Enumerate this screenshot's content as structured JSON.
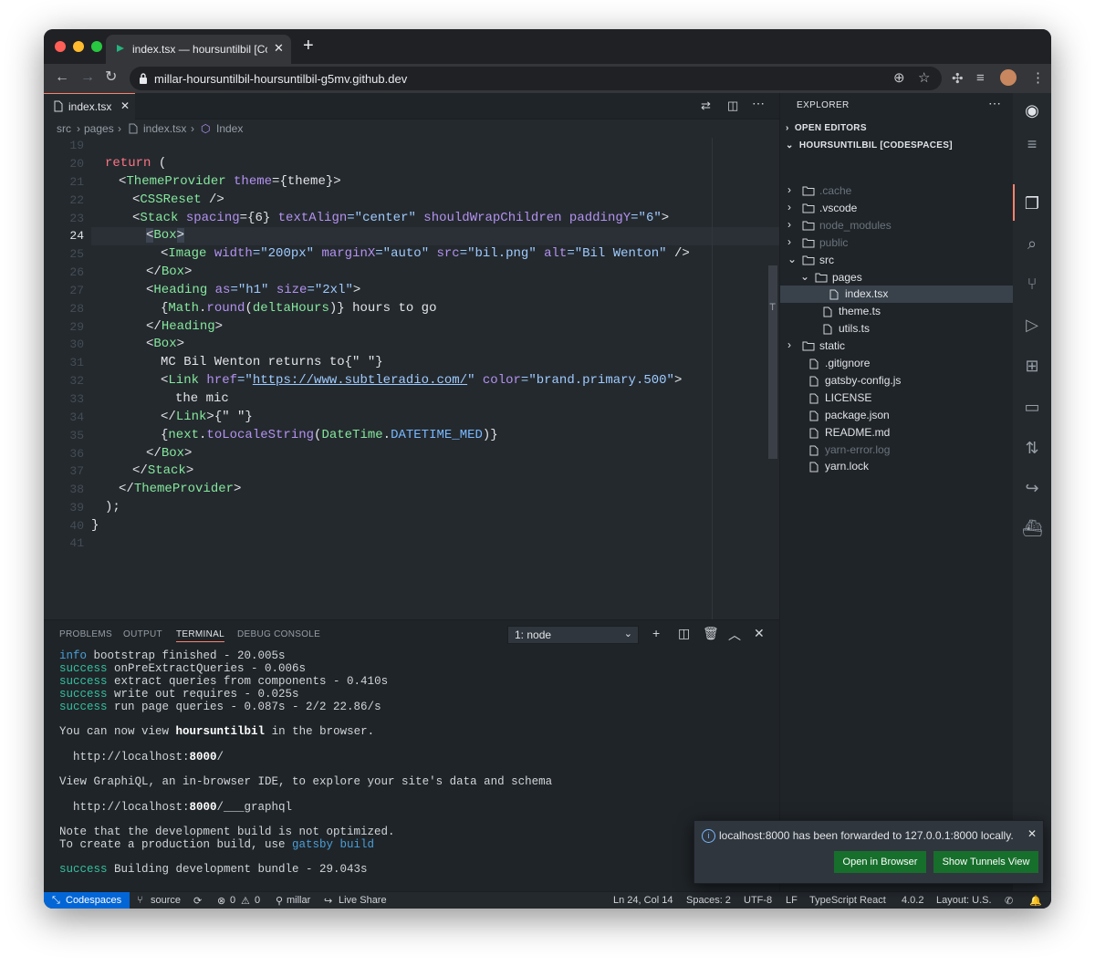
{
  "browser": {
    "tab_title": "index.tsx — hoursuntilbil [Codespaces]",
    "url": "millar-hoursuntilbil-hoursuntilbil-g5mv.github.dev"
  },
  "editor": {
    "tab": "index.tsx",
    "breadcrumb": [
      "src",
      "pages",
      "index.tsx",
      "Index"
    ],
    "line_numbers": [
      "19",
      "20",
      "21",
      "22",
      "23",
      "24",
      "25",
      "26",
      "27",
      "28",
      "29",
      "30",
      "31",
      "32",
      "33",
      "34",
      "35",
      "36",
      "37",
      "38",
      "39",
      "40",
      "41"
    ]
  },
  "code": {
    "l20_k": "return",
    "l20_p": " (",
    "l21_a": "<",
    "l21_t": "ThemeProvider",
    "l21_attr": " theme",
    "l21_rest": "={theme}>",
    "l22_a": "<",
    "l22_t": "CSSReset",
    "l22_rest": " />",
    "l23_a": "<",
    "l23_t": "Stack",
    "l23_attr1": " spacing",
    "l23_v1": "={6}",
    "l23_attr2": " textAlign",
    "l23_v2": "=\"center\"",
    "l23_attr3": " shouldWrapChildren",
    "l23_attr4": " paddingY",
    "l23_v4": "=\"6\"",
    "l23_end": ">",
    "l24_a": "<",
    "l24_t": "Box",
    "l24_end": ">",
    "l25_a": "<",
    "l25_t": "Image",
    "l25_attr1": " width",
    "l25_v1": "=\"200px\"",
    "l25_attr2": " marginX",
    "l25_v2": "=\"auto\"",
    "l25_attr3": " src",
    "l25_v3": "=\"bil.png\"",
    "l25_attr4": " alt",
    "l25_v4": "=\"Bil Wenton\"",
    "l25_end": " />",
    "l26_a": "</",
    "l26_t": "Box",
    "l26_end": ">",
    "l27_a": "<",
    "l27_t": "Heading",
    "l27_attr1": " as",
    "l27_v1": "=\"h1\"",
    "l27_attr2": " size",
    "l27_v2": "=\"2xl\"",
    "l27_end": ">",
    "l28_a": "{",
    "l28_t": "Math",
    "l28_p": ".",
    "l28_f": "round",
    "l28_b": "(",
    "l28_v": "deltaHours",
    "l28_end": ")} hours to go",
    "l29_a": "</",
    "l29_t": "Heading",
    "l29_end": ">",
    "l30_a": "<",
    "l30_t": "Box",
    "l30_end": ">",
    "l31": "MC Bil Wenton returns to{\" \"}",
    "l32_a": "<",
    "l32_t": "Link",
    "l32_attr1": " href",
    "l32_eq": "=\"",
    "l32_url": "https://www.subtleradio.com/",
    "l32_q": "\"",
    "l32_attr2": " color",
    "l32_v2": "=\"brand.primary.500\"",
    "l32_end": ">",
    "l33": "the mic",
    "l34_a": "</",
    "l34_t": "Link",
    "l34_end": ">{\" \"}",
    "l35_a": "{",
    "l35_t": "next",
    "l35_p": ".",
    "l35_f": "toLocaleString",
    "l35_b": "(",
    "l35_c": "DateTime",
    "l35_p2": ".",
    "l35_v": "DATETIME_MED",
    "l35_end": ")}",
    "l36_a": "</",
    "l36_t": "Box",
    "l36_end": ">",
    "l37_a": "</",
    "l37_t": "Stack",
    "l37_end": ">",
    "l38_a": "</",
    "l38_t": "ThemeProvider",
    "l38_end": ">",
    "l39": ");",
    "l40": "}"
  },
  "panel": {
    "tabs": [
      "PROBLEMS",
      "OUTPUT",
      "TERMINAL",
      "DEBUG CONSOLE"
    ],
    "terminal_select": "1: node"
  },
  "terminal": {
    "l1_tag": "info",
    "l1": " bootstrap finished - 20.005s",
    "l2_tag": "success",
    "l2": " onPreExtractQueries - 0.006s",
    "l3_tag": "success",
    "l3": " extract queries from components - 0.410s",
    "l4_tag": "success",
    "l4": " write out requires - 0.025s",
    "l5_tag": "success",
    "l5": " run page queries - 0.087s - 2/2 22.86/s",
    "l6_pre": "You can now view ",
    "l6_b": "hoursuntilbil",
    "l6_post": " in the browser.",
    "l7_pre": "  http://localhost:",
    "l7_b": "8000",
    "l7_post": "/",
    "l8": "View GraphiQL, an in-browser IDE, to explore your site's data and schema",
    "l9_pre": "  http://localhost:",
    "l9_b": "8000",
    "l9_post": "/___graphql",
    "l10": "Note that the development build is not optimized.",
    "l11_pre": "To create a production build, use ",
    "l11_link": "gatsby build",
    "l12_tag": "success",
    "l12": " Building development bundle - 29.043s"
  },
  "explorer": {
    "title": "EXPLORER",
    "open_editors": "OPEN EDITORS",
    "project": "HOURSUNTILBIL [CODESPACES]",
    "items": [
      {
        "label": ".cache"
      },
      {
        "label": ".vscode"
      },
      {
        "label": "node_modules"
      },
      {
        "label": "public"
      },
      {
        "label": "src"
      },
      {
        "label": "pages"
      },
      {
        "label": "index.tsx"
      },
      {
        "label": "theme.ts"
      },
      {
        "label": "utils.ts"
      },
      {
        "label": "static"
      },
      {
        "label": ".gitignore"
      },
      {
        "label": "gatsby-config.js"
      },
      {
        "label": "LICENSE"
      },
      {
        "label": "package.json"
      },
      {
        "label": "README.md"
      },
      {
        "label": "yarn-error.log"
      },
      {
        "label": "yarn.lock"
      }
    ]
  },
  "statusbar": {
    "remote": "Codespaces",
    "branch": "source",
    "errors": "0",
    "warnings": "0",
    "user": "millar",
    "live_share": "Live Share",
    "position": "Ln 24, Col 14",
    "spaces": "Spaces: 2",
    "encoding": "UTF-8",
    "eol": "LF",
    "language": "TypeScript React",
    "version": "4.0.2",
    "layout": "Layout: U.S."
  },
  "toast": {
    "message": "localhost:8000 has been forwarded to 127.0.0.1:8000 locally.",
    "open_button": "Open in Browser",
    "tunnels_button": "Show Tunnels View"
  },
  "colors": {
    "accent": "#0366d6",
    "tab_border": "#f9826c",
    "button_green": "#176f2c"
  }
}
